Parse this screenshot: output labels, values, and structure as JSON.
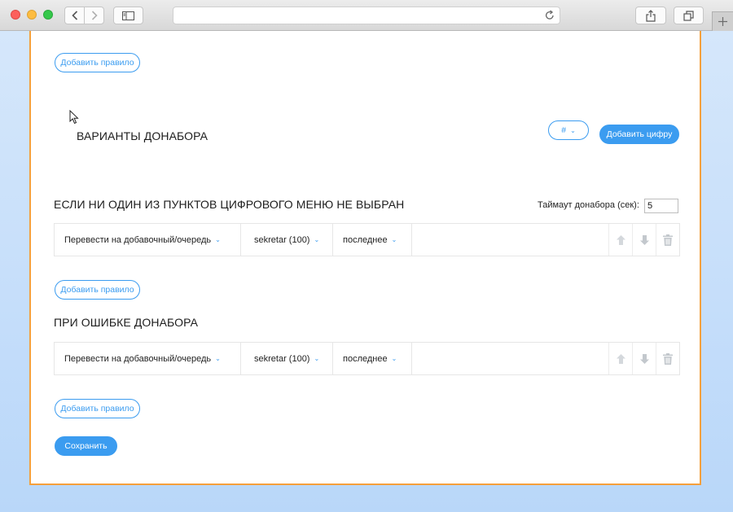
{
  "sections": {
    "top": {
      "add_rule_label": "Добавить правило"
    },
    "variants": {
      "title": "ВАРИАНТЫ ДОНАБОРА",
      "digit_select": "#",
      "add_digit_label": "Добавить цифру"
    },
    "no_selection": {
      "title": "ЕСЛИ НИ ОДИН ИЗ ПУНКТОВ ЦИФРОВОГО МЕНЮ НЕ ВЫБРАН",
      "timeout_label": "Таймаут донабора (сек):",
      "timeout_value": "5",
      "row": {
        "action": "Перевести на добавочный/очередь",
        "target": "sekretar (100)",
        "mode": "последнее"
      },
      "add_rule_label": "Добавить правило"
    },
    "error": {
      "title": "ПРИ ОШИБКЕ ДОНАБОРА",
      "row": {
        "action": "Перевести на добавочный/очередь",
        "target": "sekretar (100)",
        "mode": "последнее"
      },
      "add_rule_label": "Добавить правило"
    }
  },
  "save_label": "Сохранить",
  "colors": {
    "accent": "#3b9cf0",
    "card_border": "#f5a03c",
    "icon_muted": "#c9ced3"
  },
  "icons": [
    "back-icon",
    "forward-icon",
    "sidebar-icon",
    "reload-icon",
    "share-icon",
    "tabs-icon",
    "new-tab-icon",
    "chevron-down-icon",
    "arrow-up-icon",
    "arrow-down-icon",
    "trash-icon",
    "cursor-icon"
  ]
}
